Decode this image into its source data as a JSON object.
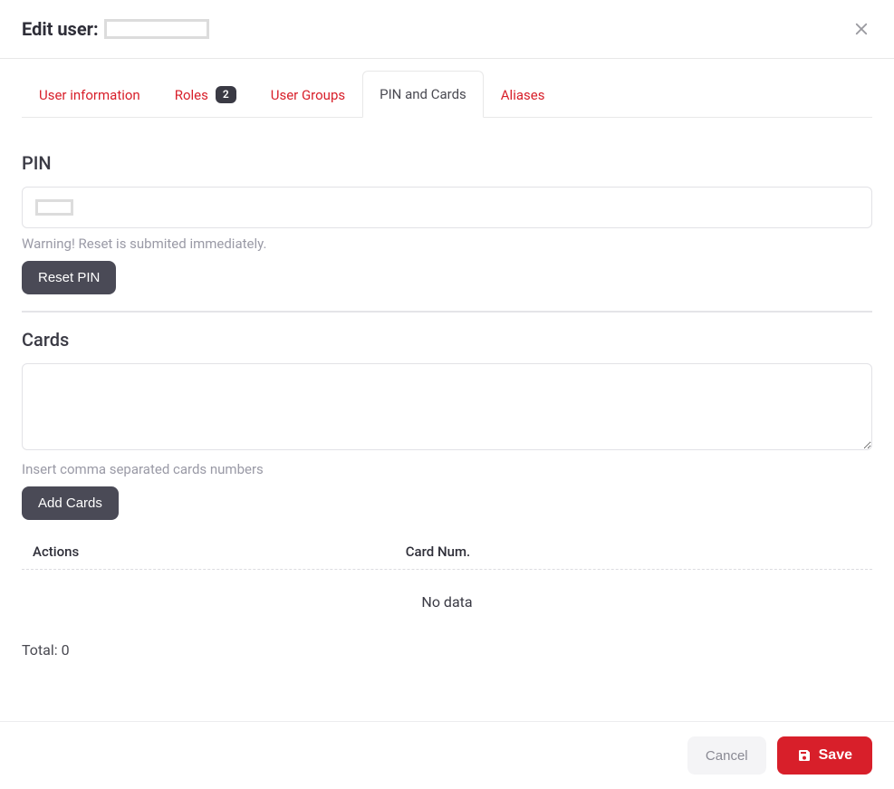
{
  "header": {
    "title": "Edit user:"
  },
  "tabs": [
    {
      "label": "User information"
    },
    {
      "label": "Roles",
      "badge": "2"
    },
    {
      "label": "User Groups"
    },
    {
      "label": "PIN and Cards",
      "active": true
    },
    {
      "label": "Aliases"
    }
  ],
  "pin": {
    "heading": "PIN",
    "warning": "Warning! Reset is submited immediately.",
    "reset_label": "Reset PIN"
  },
  "cards": {
    "heading": "Cards",
    "hint": "Insert comma separated cards numbers",
    "add_label": "Add Cards",
    "table": {
      "col_actions": "Actions",
      "col_card": "Card Num.",
      "empty": "No data",
      "total_label": "Total:",
      "total_value": "0"
    }
  },
  "footer": {
    "cancel": "Cancel",
    "save": "Save"
  }
}
